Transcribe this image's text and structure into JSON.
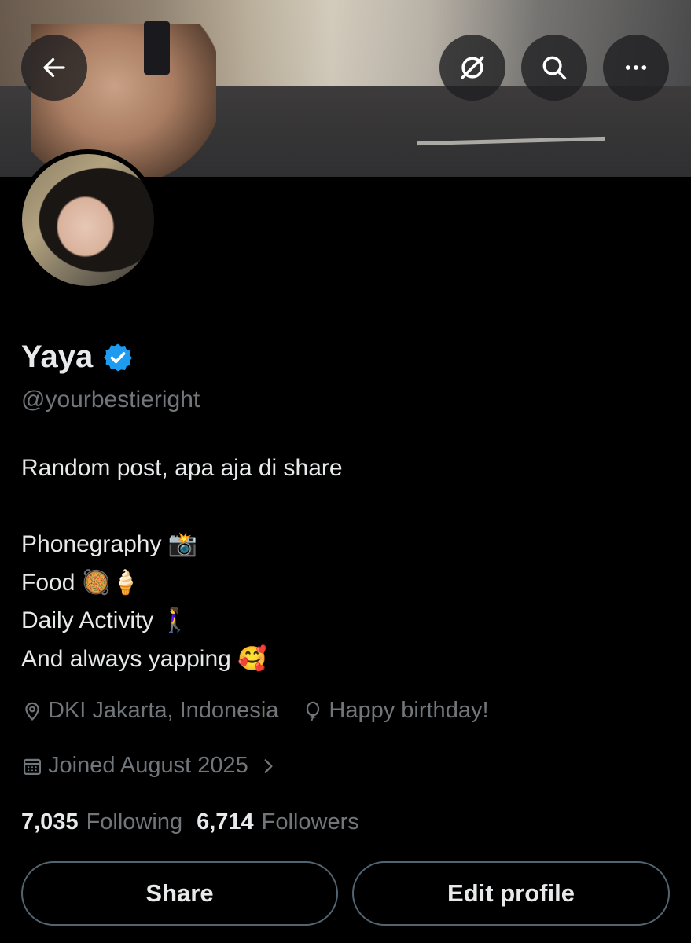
{
  "header": {
    "back_icon": "arrow-left-icon",
    "grok_icon": "grok-icon",
    "search_icon": "search-icon",
    "more_icon": "more-horizontal-icon"
  },
  "profile": {
    "name": "Yaya",
    "verified": true,
    "verified_color": "#1d9bf0",
    "handle": "@yourbestieright",
    "bio": {
      "line1": "Random post, apa aja di share",
      "line2": "Phonegraphy 📸",
      "line3": "Food 🥘🍦",
      "line4": "Daily Activity 🚶‍♀️",
      "line5": "And always yapping 🥰"
    },
    "location": "DKI Jakarta, Indonesia",
    "birthday": "Happy birthday!",
    "joined": "Joined August 2025"
  },
  "stats": {
    "following_count": "7,035",
    "following_label": "Following",
    "followers_count": "6,714",
    "followers_label": "Followers"
  },
  "actions": {
    "share_label": "Share",
    "edit_label": "Edit profile"
  },
  "colors": {
    "background": "#000000",
    "text_primary": "#e7e9ea",
    "text_secondary": "#71767b",
    "border": "#536471",
    "verified": "#1d9bf0"
  }
}
